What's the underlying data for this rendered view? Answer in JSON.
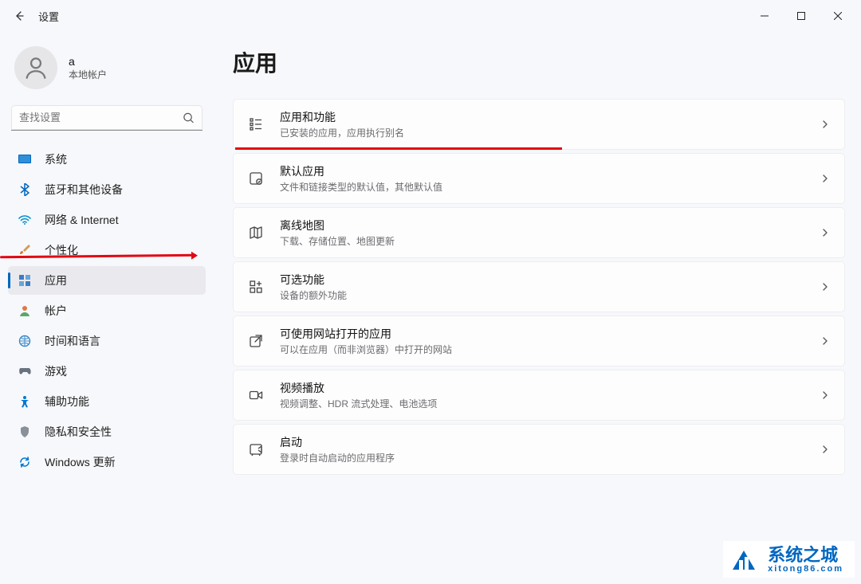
{
  "window": {
    "title": "设置"
  },
  "account": {
    "name": "a",
    "type": "本地帐户"
  },
  "search": {
    "placeholder": "查找设置"
  },
  "sidebar": {
    "items": [
      {
        "label": "系统"
      },
      {
        "label": "蓝牙和其他设备"
      },
      {
        "label": "网络 & Internet"
      },
      {
        "label": "个性化"
      },
      {
        "label": "应用"
      },
      {
        "label": "帐户"
      },
      {
        "label": "时间和语言"
      },
      {
        "label": "游戏"
      },
      {
        "label": "辅助功能"
      },
      {
        "label": "隐私和安全性"
      },
      {
        "label": "Windows 更新"
      }
    ]
  },
  "page": {
    "title": "应用",
    "cards": [
      {
        "title": "应用和功能",
        "desc": "已安装的应用，应用执行别名"
      },
      {
        "title": "默认应用",
        "desc": "文件和链接类型的默认值，其他默认值"
      },
      {
        "title": "离线地图",
        "desc": "下载、存储位置、地图更新"
      },
      {
        "title": "可选功能",
        "desc": "设备的额外功能"
      },
      {
        "title": "可使用网站打开的应用",
        "desc": "可以在应用（而非浏览器）中打开的网站"
      },
      {
        "title": "视频播放",
        "desc": "视频调整、HDR 流式处理、电池选项"
      },
      {
        "title": "启动",
        "desc": "登录时自动启动的应用程序"
      }
    ]
  },
  "watermark": {
    "cn": "系统之城",
    "en": "xitong86.com"
  }
}
